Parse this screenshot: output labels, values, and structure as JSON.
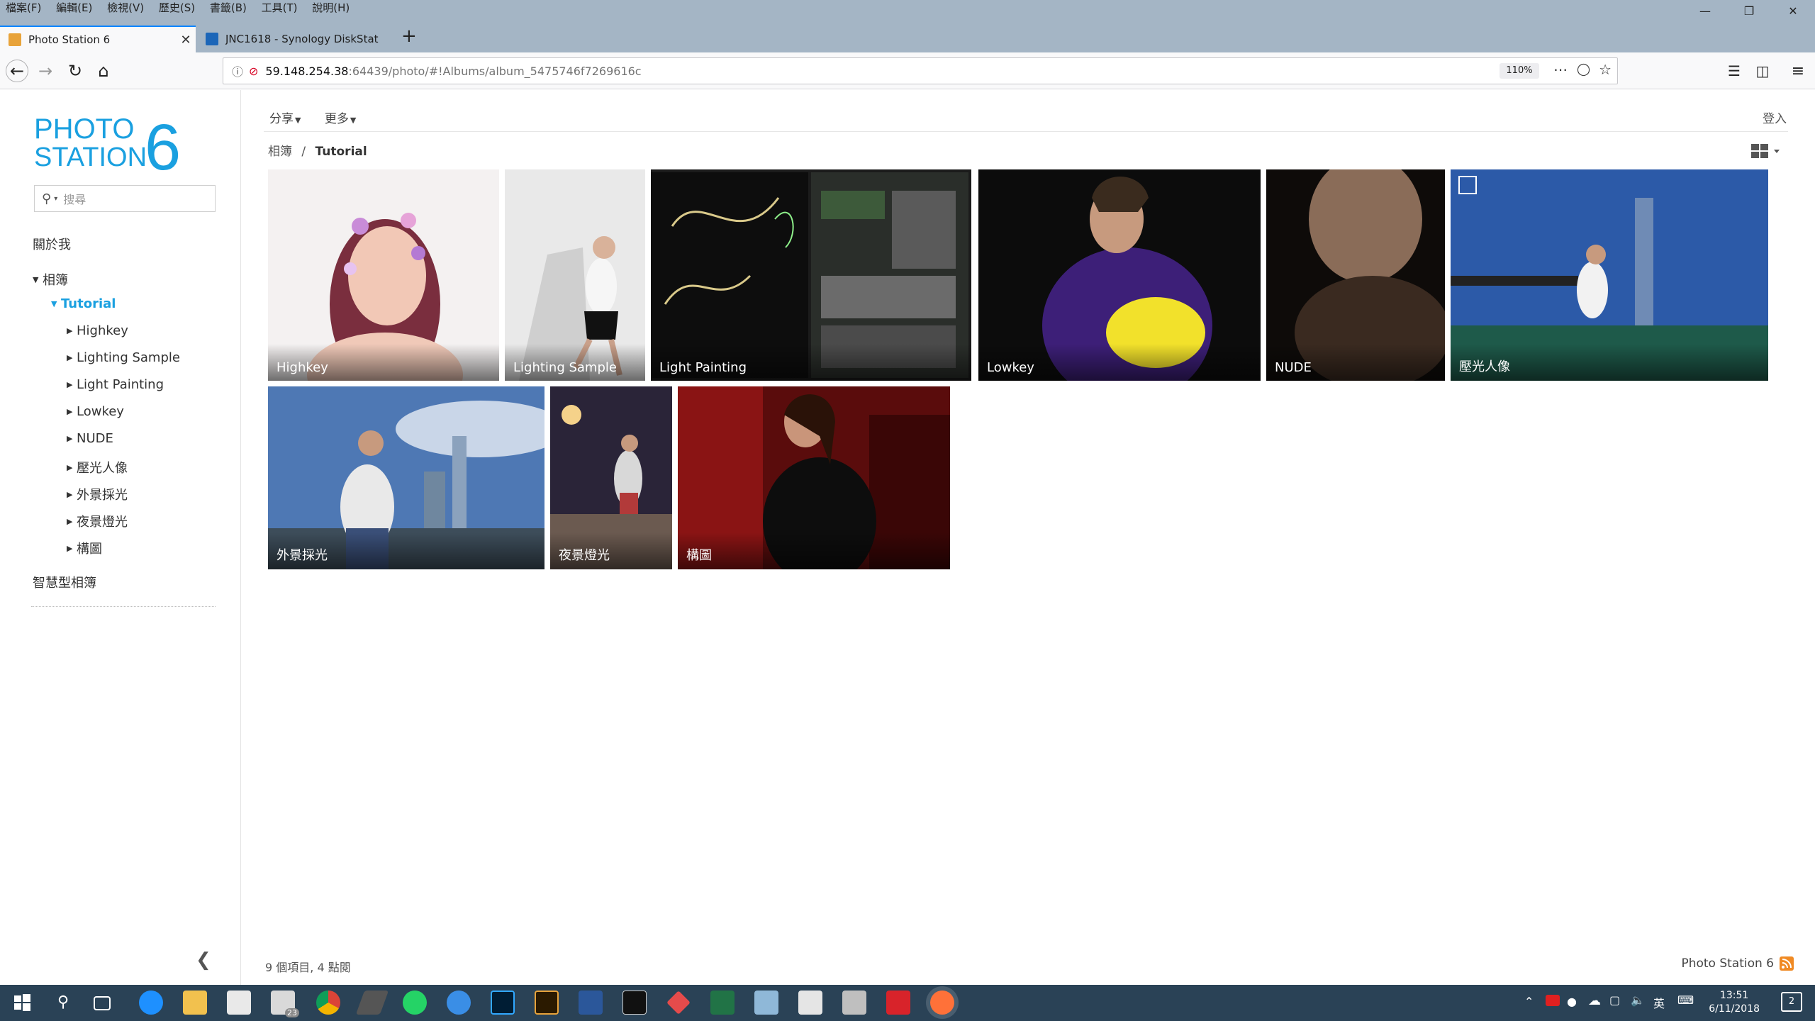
{
  "browser": {
    "menu": [
      "檔案(F)",
      "編輯(E)",
      "檢視(V)",
      "歷史(S)",
      "書籤(B)",
      "工具(T)",
      "說明(H)"
    ],
    "tabs": [
      {
        "label": "Photo Station 6",
        "active": true
      },
      {
        "label": "JNC1618 - Synology DiskStat",
        "active": false
      }
    ],
    "url_host": "59.148.254.38",
    "url_rest": ":64439/photo/#!Albums/album_5475746f7269616c",
    "zoom": "110%"
  },
  "app": {
    "logo_line1": "PHOTO",
    "logo_line2": "STATION",
    "logo_num": "6",
    "search_placeholder": "搜尋",
    "toolbar": {
      "share": "分享",
      "more": "更多",
      "login": "登入"
    },
    "breadcrumb": {
      "root": "相簿",
      "separator": "/",
      "current": "Tutorial"
    }
  },
  "sidebar": {
    "about": "關於我",
    "albums": "相簿",
    "tutorial": "Tutorial",
    "children": [
      "Highkey",
      "Lighting Sample",
      "Light Painting",
      "Lowkey",
      "NUDE",
      "壓光人像",
      "外景採光",
      "夜景燈光",
      "構圖"
    ],
    "smart": "智慧型相簿"
  },
  "grid": {
    "items": [
      {
        "label": "Highkey"
      },
      {
        "label": "Lighting Sample"
      },
      {
        "label": "Light Painting"
      },
      {
        "label": "Lowkey"
      },
      {
        "label": "NUDE"
      },
      {
        "label": "壓光人像"
      },
      {
        "label": "外景採光"
      },
      {
        "label": "夜景燈光"
      },
      {
        "label": "構圖"
      }
    ]
  },
  "footer": {
    "status": "9 個項目, 4 點閱",
    "brand": "Photo Station 6"
  },
  "taskbar": {
    "time": "13:51",
    "date": "6/11/2018",
    "mail_badge": "23",
    "ime": "英",
    "notification_count": "2"
  },
  "colors": {
    "accent": "#1aa0e0",
    "chrome": "#a4b5c5",
    "taskbar": "#2a4256"
  }
}
